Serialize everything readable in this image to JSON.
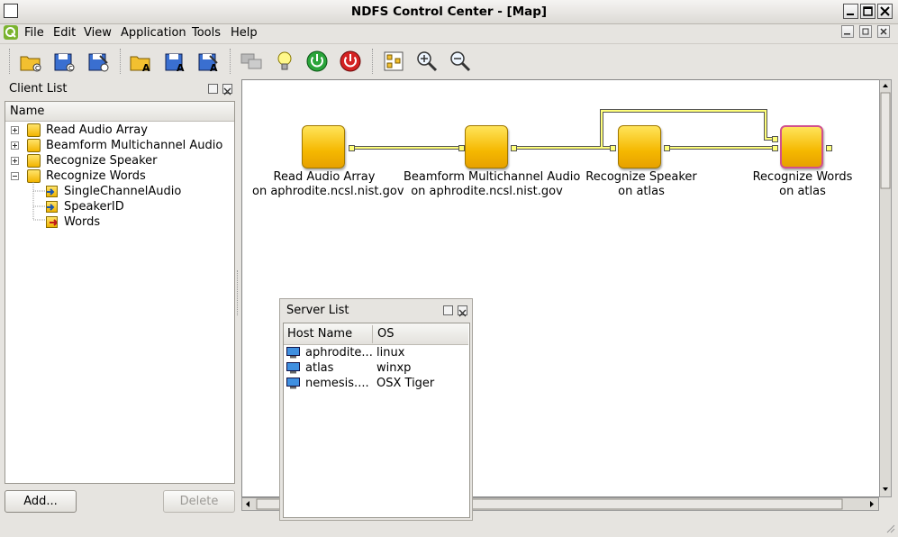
{
  "window": {
    "title": "NDFS Control Center - [Map]"
  },
  "menu": [
    "File",
    "Edit",
    "View",
    "Application",
    "Tools",
    "Help"
  ],
  "toolbar_icons": [
    "open-icon",
    "save-icon",
    "save-as-icon",
    "open-app-icon",
    "save-app-icon",
    "save-app-as-icon",
    "connect-icon",
    "lightbulb-icon",
    "power-on-icon",
    "power-off-icon",
    "layout-icon",
    "zoom-in-icon",
    "zoom-out-icon"
  ],
  "client_panel": {
    "title": "Client List",
    "header": "Name",
    "items": [
      "Read Audio Array",
      "Beamform Multichannel Audio",
      "Recognize Speaker",
      "Recognize Words"
    ],
    "children": [
      "SingleChannelAudio",
      "SpeakerID",
      "Words"
    ],
    "add_label": "Add...",
    "delete_label": "Delete"
  },
  "map": {
    "nodes": [
      {
        "name": "Read Audio Array",
        "host": "on aphrodite.ncsl.nist.gov"
      },
      {
        "name": "Beamform Multichannel Audio",
        "host": "on aphrodite.ncsl.nist.gov"
      },
      {
        "name": "Recognize Speaker",
        "host": "on atlas"
      },
      {
        "name": "Recognize Words",
        "host": "on atlas"
      }
    ]
  },
  "server_panel": {
    "title": "Server List",
    "col_host": "Host Name",
    "col_os": "OS",
    "rows": [
      {
        "host": "aphrodite...",
        "os": "linux"
      },
      {
        "host": "atlas",
        "os": "winxp"
      },
      {
        "host": "nemesis....",
        "os": "OSX Tiger"
      }
    ]
  },
  "colors": {
    "node": "#f5b800",
    "selected_border": "#d0508e",
    "link": "#ffff7a"
  }
}
